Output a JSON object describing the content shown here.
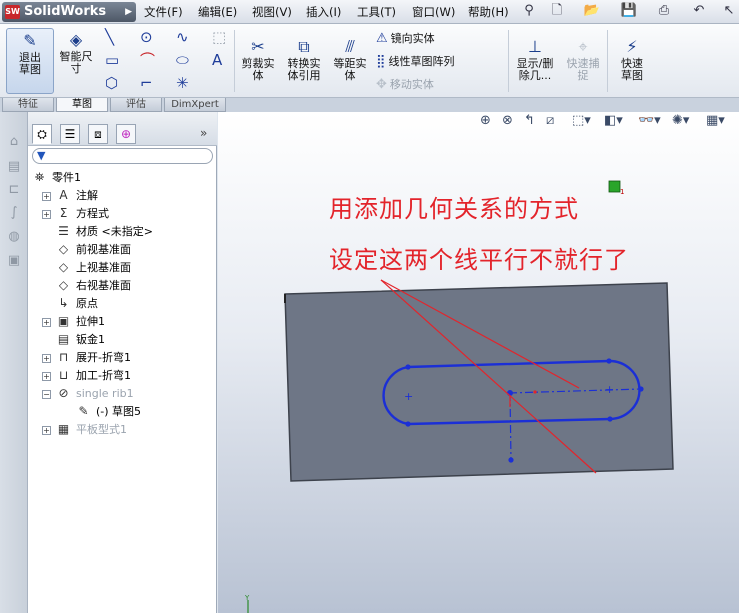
{
  "app": {
    "logo": "SolidWorks",
    "menu": [
      "文件(F)",
      "编辑(E)",
      "视图(V)",
      "插入(I)",
      "工具(T)",
      "窗口(W)",
      "帮助(H)"
    ]
  },
  "ribbon": {
    "exit_sketch": "退出草图",
    "smart_dimension": "智能尺寸",
    "trim": "剪裁实体",
    "convert": "转换实体引用",
    "offset": "等距实体",
    "mirror": "镜向实体",
    "linear_pattern": "线性草图阵列",
    "move": "移动实体",
    "display_delete": "显示/删除几...",
    "quick_snap": "快速捕捉",
    "rapid_sketch": "快速草图"
  },
  "tabs": [
    "特征",
    "草图",
    "评估",
    "DimXpert"
  ],
  "active_tab": "草图",
  "tree": [
    {
      "label": "零件1",
      "icon": "part-icon",
      "expander": "",
      "indent": 0,
      "grey": false
    },
    {
      "label": "注解",
      "icon": "annotations-icon",
      "expander": "+",
      "indent": 1,
      "grey": false
    },
    {
      "label": "方程式",
      "icon": "equations-icon",
      "expander": "+",
      "indent": 1,
      "grey": false
    },
    {
      "label": "材质 <未指定>",
      "icon": "material-icon",
      "expander": "",
      "indent": 1,
      "grey": false
    },
    {
      "label": "前视基准面",
      "icon": "plane-icon",
      "expander": "",
      "indent": 1,
      "grey": false
    },
    {
      "label": "上视基准面",
      "icon": "plane-icon",
      "expander": "",
      "indent": 1,
      "grey": false
    },
    {
      "label": "右视基准面",
      "icon": "plane-icon",
      "expander": "",
      "indent": 1,
      "grey": false
    },
    {
      "label": "原点",
      "icon": "origin-icon",
      "expander": "",
      "indent": 1,
      "grey": false
    },
    {
      "label": "拉伸1",
      "icon": "extrude-icon",
      "expander": "+",
      "indent": 1,
      "grey": false
    },
    {
      "label": "钣金1",
      "icon": "sheetmetal-icon",
      "expander": "",
      "indent": 1,
      "grey": false
    },
    {
      "label": "展开-折弯1",
      "icon": "unfold-icon",
      "expander": "+",
      "indent": 1,
      "grey": false
    },
    {
      "label": "加工-折弯1",
      "icon": "process-bend-icon",
      "expander": "+",
      "indent": 1,
      "grey": false
    },
    {
      "label": "single rib1",
      "icon": "rib-icon",
      "expander": "−",
      "indent": 1,
      "grey": true
    },
    {
      "label": "(-) 草图5",
      "icon": "sketch-icon",
      "expander": "",
      "indent": 2,
      "grey": false
    },
    {
      "label": "平板型式1",
      "icon": "flat-pattern-icon",
      "expander": "+",
      "indent": 1,
      "grey": true
    }
  ],
  "annotation": {
    "line1": "用添加几何关系的方式",
    "line2": "设定这两个线平行不就行了"
  },
  "colors": {
    "sketch": "#1b2fd6",
    "annotation": "#e3242b",
    "panel": "#6e7686"
  }
}
